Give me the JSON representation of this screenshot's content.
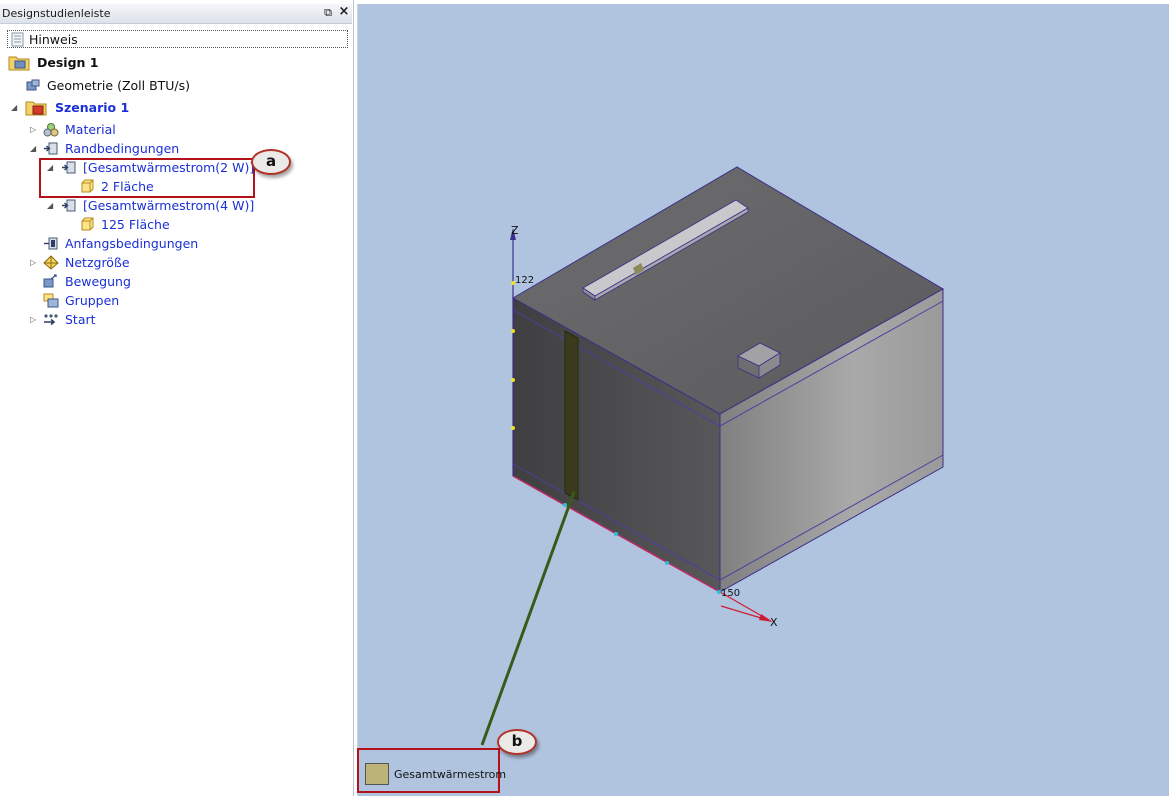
{
  "panel": {
    "title": "Designstudienleiste",
    "float_glyph": "⧉",
    "close_glyph": "×"
  },
  "tree": {
    "hinweis": "Hinweis",
    "design": "Design 1",
    "geometrie": "Geometrie (Zoll BTU/s)",
    "szenario": "Szenario 1",
    "material": "Material",
    "randbedingungen": "Randbedingungen",
    "bc1": "[Gesamtwärmestrom(2 W)]",
    "bc1_child": "2 Fläche",
    "bc2": "[Gesamtwärmestrom(4 W)]",
    "bc2_child": "125 Fläche",
    "anfang": "Anfangsbedingungen",
    "netz": "Netzgröße",
    "bewegung": "Bewegung",
    "gruppen": "Gruppen",
    "start": "Start"
  },
  "callouts": {
    "a": "a",
    "b": "b"
  },
  "viewport": {
    "axis_z": "Z",
    "axis_x": "X",
    "tick_z": "122",
    "tick_x": "150",
    "legend_label": "Gesamtwärmestrom",
    "legend_color": "#bcb476",
    "background": "#b1c4df"
  }
}
